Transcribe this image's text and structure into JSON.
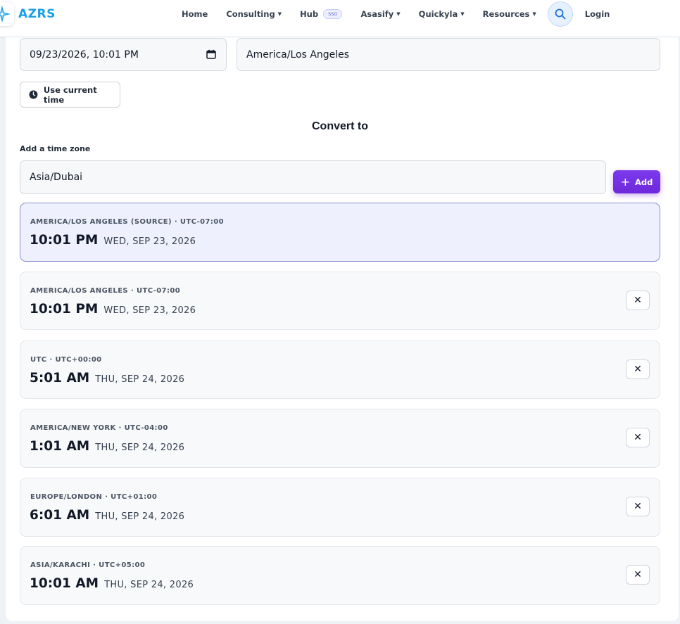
{
  "brand": {
    "name": "AZRS",
    "color": "#1ba0e6"
  },
  "nav": {
    "items": [
      {
        "label": "Home",
        "dropdown": false
      },
      {
        "label": "Consulting",
        "dropdown": true
      },
      {
        "label": "Hub",
        "dropdown": false,
        "badge": "SSO"
      },
      {
        "label": "Asasify",
        "dropdown": true
      },
      {
        "label": "Quickyla",
        "dropdown": true
      },
      {
        "label": "Resources",
        "dropdown": true
      }
    ],
    "login_label": "Login",
    "search_icon": "search-icon"
  },
  "converter": {
    "datetime_value": "09/23/2026, 10:01 PM",
    "source_timezone": "America/Los Angeles",
    "use_current_time_label": "Use current time",
    "convert_to_title": "Convert to",
    "add_zone_label": "Add a time zone",
    "add_zone_value": "Asia/Dubai",
    "add_button_label": "Add",
    "accent_color": "#6d28d9"
  },
  "zones": [
    {
      "meta": "AMERICA/LOS ANGELES (SOURCE) · UTC-07:00",
      "time": "10:01 PM",
      "date": "WED, SEP 23, 2026",
      "source": true
    },
    {
      "meta": "AMERICA/LOS ANGELES · UTC-07:00",
      "time": "10:01 PM",
      "date": "WED, SEP 23, 2026",
      "source": false
    },
    {
      "meta": "UTC · UTC+00:00",
      "time": "5:01 AM",
      "date": "THU, SEP 24, 2026",
      "source": false
    },
    {
      "meta": "AMERICA/NEW YORK · UTC-04:00",
      "time": "1:01 AM",
      "date": "THU, SEP 24, 2026",
      "source": false
    },
    {
      "meta": "EUROPE/LONDON · UTC+01:00",
      "time": "6:01 AM",
      "date": "THU, SEP 24, 2026",
      "source": false
    },
    {
      "meta": "ASIA/KARACHI · UTC+05:00",
      "time": "10:01 AM",
      "date": "THU, SEP 24, 2026",
      "source": false
    }
  ],
  "remove_label": "✕"
}
